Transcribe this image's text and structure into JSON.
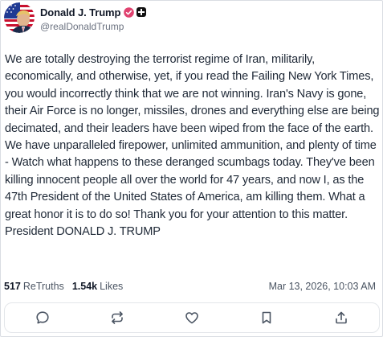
{
  "post": {
    "author": {
      "display_name": "Donald J. Trump",
      "handle": "@realDonaldTrump",
      "avatar_icon": "flag-portrait-avatar",
      "verified_color": "#e0426f"
    },
    "text": "We are totally destroying the terrorist regime of Iran, militarily, economically, and otherwise, yet, if you read the Failing New York Times, you would incorrectly think that we are not winning. Iran's Navy is gone, their Air Force is no longer, missiles, drones and everything else are being decimated, and their leaders have been wiped from the face of the earth. We have unparalleled firepower, unlimited ammunition, and plenty of time - Watch what happens to these deranged scumbags today. They've been killing innocent people all over the world for 47 years, and now I, as the 47th President of the United States of America, am killing them. What a great honor it is to do so! Thank you for your attention to this matter. President DONALD J. TRUMP",
    "stats": {
      "retruths_count": "517",
      "retruths_label": "ReTruths",
      "likes_count": "1.54k",
      "likes_label": "Likes"
    },
    "timestamp": "Mar 13, 2026, 10:03 AM",
    "actions": [
      {
        "name": "reply",
        "icon": "comment-icon"
      },
      {
        "name": "retruth",
        "icon": "repost-icon"
      },
      {
        "name": "like",
        "icon": "heart-icon"
      },
      {
        "name": "bookmark",
        "icon": "bookmark-icon"
      },
      {
        "name": "share",
        "icon": "share-icon"
      }
    ]
  }
}
